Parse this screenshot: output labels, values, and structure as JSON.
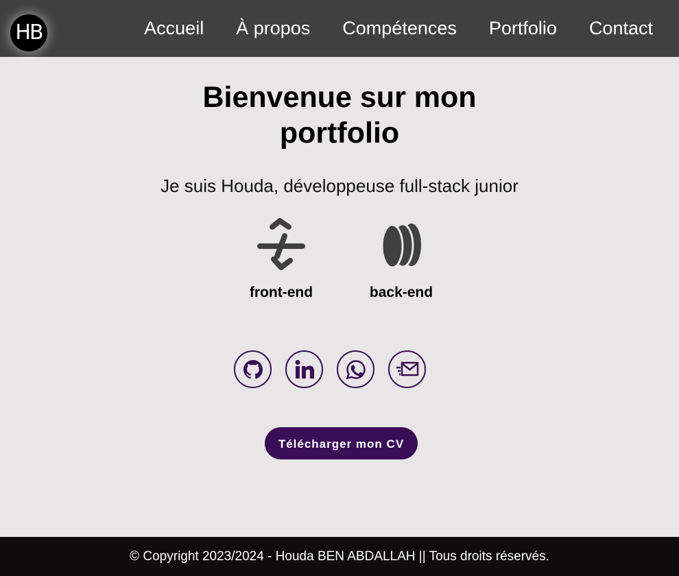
{
  "logo": {
    "text": "HB"
  },
  "nav": {
    "items": [
      {
        "label": "Accueil"
      },
      {
        "label": "À propos"
      },
      {
        "label": "Compétences"
      },
      {
        "label": "Portfolio"
      },
      {
        "label": "Contact"
      }
    ]
  },
  "hero": {
    "title_line1": "Bienvenue sur mon",
    "title_line2": "portfolio",
    "subtitle": "Je suis Houda, développeuse full-stack junior"
  },
  "skills": [
    {
      "label": "front-end",
      "icon": "code-icon"
    },
    {
      "label": "back-end",
      "icon": "database-icon"
    }
  ],
  "socials": [
    {
      "icon": "github-icon"
    },
    {
      "icon": "linkedin-icon"
    },
    {
      "icon": "whatsapp-icon"
    },
    {
      "icon": "mail-icon"
    }
  ],
  "cv_button": {
    "label": "Télécharger mon CV"
  },
  "footer": {
    "text": "© Copyright 2023/2024 - Houda BEN ABDALLAH || Tous droits réservés."
  },
  "colors": {
    "navbar": "#404040",
    "background": "#e8e6e6",
    "accent": "#3b0d56",
    "footer": "#0e0c0d"
  }
}
